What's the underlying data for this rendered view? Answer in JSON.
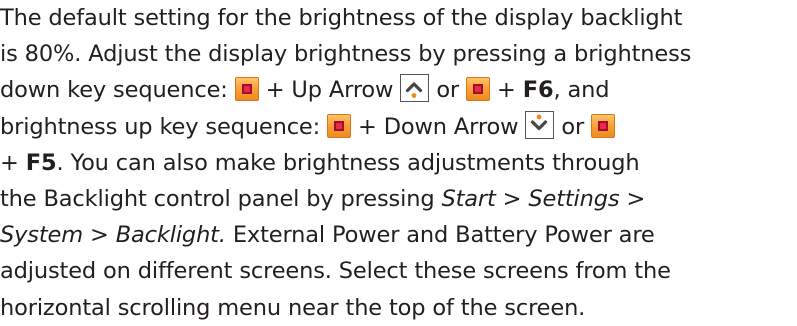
{
  "paragraph": {
    "l1": "The default setting for the brightness of the display backlight",
    "l2": "is 80%. Adjust the display brightness by pressing a brightness",
    "l3a": "down key sequence: ",
    "l3b": " + Up Arrow ",
    "l3c": " or ",
    "l3d": " + ",
    "l3e": "F6",
    "l3f": ", and",
    "l4a": "brightness up key sequence: ",
    "l4b": " + Down Arrow ",
    "l4c": " or ",
    "l5a": "+ ",
    "l5b": "F5",
    "l5c": ". You can also make brightness adjustments through",
    "l6a": "the Backlight control panel by pressing ",
    "l6b": "Start > Settings >",
    "l7a": "System > Backlight.",
    "l7b": " External Power and Battery Power are",
    "l8": "adjusted on different screens. Select these screens from the",
    "l9": "horizontal scrolling menu near the top of the screen."
  },
  "icons": {
    "function_key": "orange-function-key-icon",
    "up_arrow": "up-arrow-key-icon",
    "down_arrow": "down-arrow-key-icon"
  },
  "colors": {
    "text": "#231f20",
    "key_orange": "#f9a23a",
    "key_center": "#e8284f",
    "arrow_glyph": "#f08a1f"
  }
}
